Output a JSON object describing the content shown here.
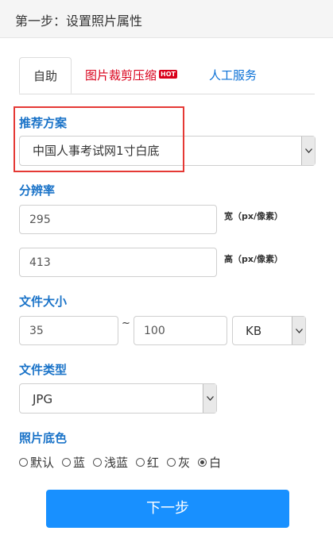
{
  "header": {
    "title": "第一步：设置照片属性"
  },
  "tabs": [
    {
      "label": "自助"
    },
    {
      "label": "图片裁剪压缩",
      "badge": "HOT"
    },
    {
      "label": "人工服务"
    }
  ],
  "scheme": {
    "label": "推荐方案",
    "value": "中国人事考试网1寸白底"
  },
  "resolution": {
    "label": "分辨率",
    "width_value": "295",
    "width_unit": "宽（px/像素）",
    "height_value": "413",
    "height_unit": "高（px/像素）"
  },
  "filesize": {
    "label": "文件大小",
    "min": "35",
    "separator": "~",
    "max": "100",
    "unit": "KB"
  },
  "filetype": {
    "label": "文件类型",
    "value": "JPG"
  },
  "bgcolor": {
    "label": "照片底色",
    "options": [
      "默认",
      "蓝",
      "浅蓝",
      "红",
      "灰",
      "白"
    ],
    "selected": "白"
  },
  "next_button": "下一步"
}
